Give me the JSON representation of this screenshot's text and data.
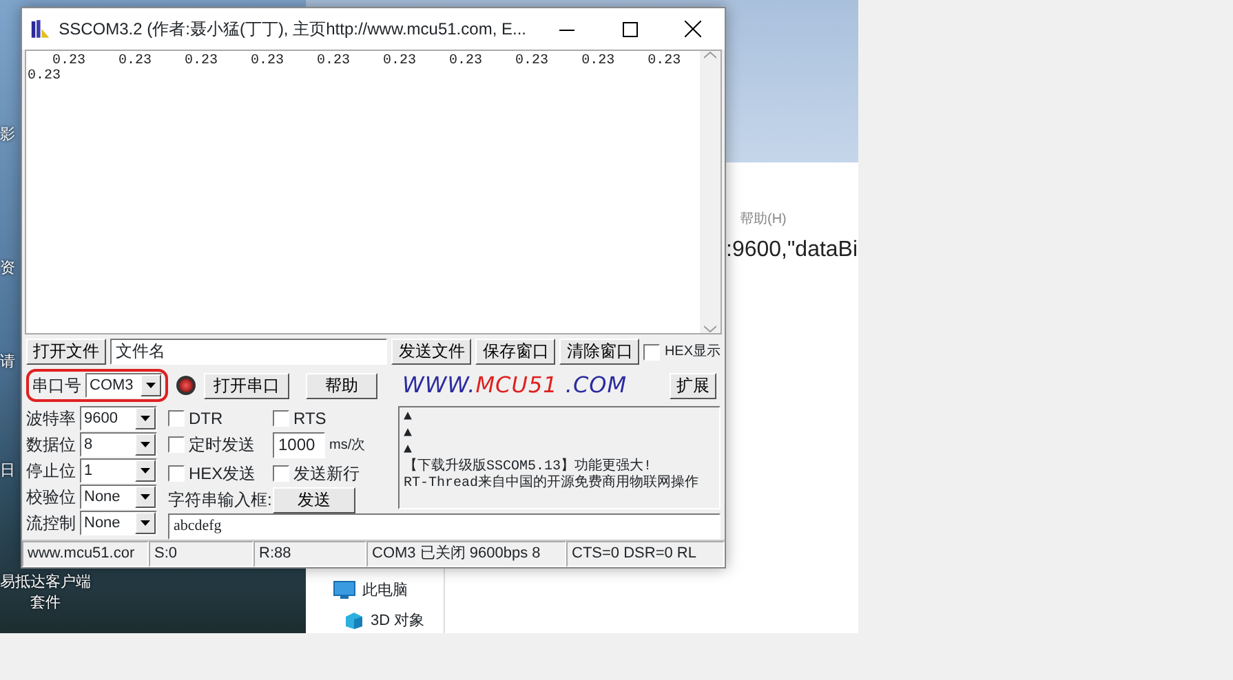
{
  "desktop": {
    "labels": [
      {
        "text": "影",
        "kind": "edge"
      },
      {
        "text": "资",
        "kind": "edge"
      },
      {
        "text": "请",
        "kind": "edge"
      },
      {
        "text": "日",
        "kind": "edge"
      },
      {
        "text": "易抵达客户端",
        "kind": "icon_label"
      },
      {
        "text": "套件",
        "kind": "icon_label"
      }
    ]
  },
  "background_window": {
    "menu_item": "帮助(H)",
    "content_text": ":9600,\"dataBi",
    "nav_items": [
      {
        "label": "此电脑",
        "kind": "pc"
      },
      {
        "label": "3D 对象",
        "kind": "cube"
      }
    ]
  },
  "window": {
    "title": "SSCOM3.2 (作者:聂小猛(丁丁), 主页http://www.mcu51.com,  E..."
  },
  "receive": {
    "lines": [
      "   0.23    0.23    0.23    0.23    0.23    0.23    0.23    0.23    0.23    0.23",
      "0.23"
    ]
  },
  "file_row": {
    "open_button": "打开文件",
    "file_field": {
      "value": "文件名"
    },
    "buttons": [
      "发送文件",
      "保存窗口",
      "清除窗口"
    ],
    "hex_display": {
      "label": "HEX显示",
      "checked": false
    }
  },
  "port_row": {
    "port_label": "串口号",
    "port_value": "COM3",
    "highlighted": true,
    "port_open": false,
    "open_button": "打开串口",
    "help_button": "帮助",
    "logo": [
      {
        "text": "WWW.",
        "color": "#2b2ba0"
      },
      {
        "text": "MCU51",
        "color": "#e02020"
      },
      {
        "text": " .COM",
        "color": "#2b2ba0"
      }
    ],
    "expand_button": "扩展"
  },
  "settings": [
    {
      "label": "波特率",
      "value": "9600"
    },
    {
      "label": "数据位",
      "value": "8"
    },
    {
      "label": "停止位",
      "value": "1"
    },
    {
      "label": "校验位",
      "value": "None"
    },
    {
      "label": "流控制",
      "value": "None"
    }
  ],
  "options": [
    {
      "label": "DTR",
      "checked": false
    },
    {
      "label": "RTS",
      "checked": false
    },
    {
      "label": "定时发送",
      "checked": false
    },
    {
      "label": "HEX发送",
      "checked": false
    },
    {
      "label": "发送新行",
      "checked": false
    }
  ],
  "interval": {
    "value": "1000",
    "unit": "ms/次"
  },
  "send": {
    "label": "字符串输入框:",
    "button": "发送",
    "value": "abcdefg"
  },
  "info_lines": [
    "▲",
    "▲",
    "▲",
    "【下载升级版SSCOM5.13】功能更强大!",
    "RT-Thread来自中国的开源免费商用物联网操作"
  ],
  "status_bar": [
    "www.mcu51.cor",
    "S:0",
    "R:88",
    "COM3 已关闭  9600bps  8",
    "CTS=0 DSR=0 RL"
  ]
}
